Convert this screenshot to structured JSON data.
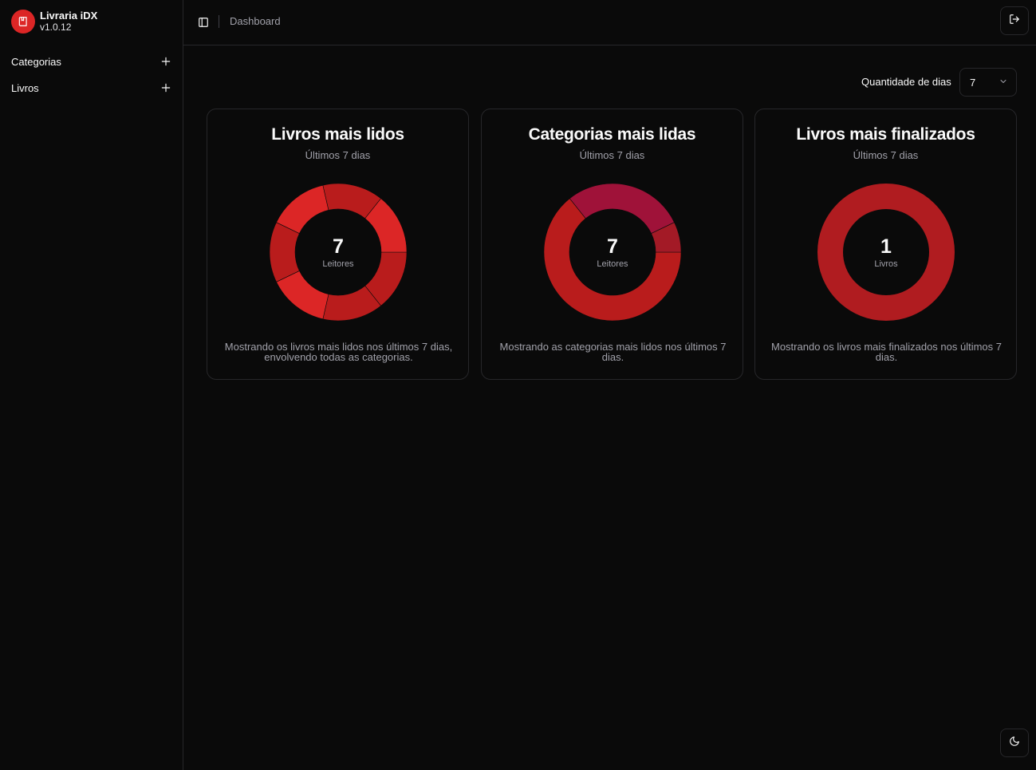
{
  "app": {
    "name": "Livraria iDX",
    "version": "v1.0.12"
  },
  "sidebar": {
    "items": [
      {
        "label": "Categorias"
      },
      {
        "label": "Livros"
      }
    ]
  },
  "header": {
    "breadcrumb": "Dashboard"
  },
  "filter": {
    "label": "Quantidade de dias",
    "selected": "7"
  },
  "cards": [
    {
      "title": "Livros mais lidos",
      "subtitle": "Últimos 7 dias",
      "total": "7",
      "unit": "Leitores",
      "footer": "Mostrando os livros mais lidos nos últimos 7 dias, envolvendo todas as categorias.",
      "segments": [
        {
          "value": 1,
          "color": "#b91c1c"
        },
        {
          "value": 1,
          "color": "#b91c1c"
        },
        {
          "value": 1,
          "color": "#dc2626"
        },
        {
          "value": 1,
          "color": "#b91c1c"
        },
        {
          "value": 1,
          "color": "#dc2626"
        },
        {
          "value": 1,
          "color": "#b91c1c"
        },
        {
          "value": 1,
          "color": "#dc2626"
        }
      ]
    },
    {
      "title": "Categorias mais lidas",
      "subtitle": "Últimos 7 dias",
      "total": "7",
      "unit": "Leitores",
      "footer": "Mostrando as categorias mais lidos nos últimos 7 dias.",
      "segments": [
        {
          "value": 4.5,
          "color": "#b91c1c"
        },
        {
          "value": 2,
          "color": "#9f1239"
        },
        {
          "value": 0.5,
          "color": "#a31a26"
        }
      ]
    },
    {
      "title": "Livros mais finalizados",
      "subtitle": "Últimos 7 dias",
      "total": "1",
      "unit": "Livros",
      "footer": "Mostrando os livros mais finalizados nos últimos 7 dias.",
      "segments": [
        {
          "value": 1,
          "color": "#b01c20"
        }
      ]
    }
  ],
  "icons": {
    "logo": "book-icon",
    "add": "plus-icon",
    "sidebar_toggle": "panel-left-icon",
    "logout": "log-out-icon",
    "theme": "moon-icon",
    "select": "chevron-down-icon"
  },
  "colors": {
    "accent": "#dc2626",
    "background": "#0a0a0a",
    "border": "#27272a"
  }
}
